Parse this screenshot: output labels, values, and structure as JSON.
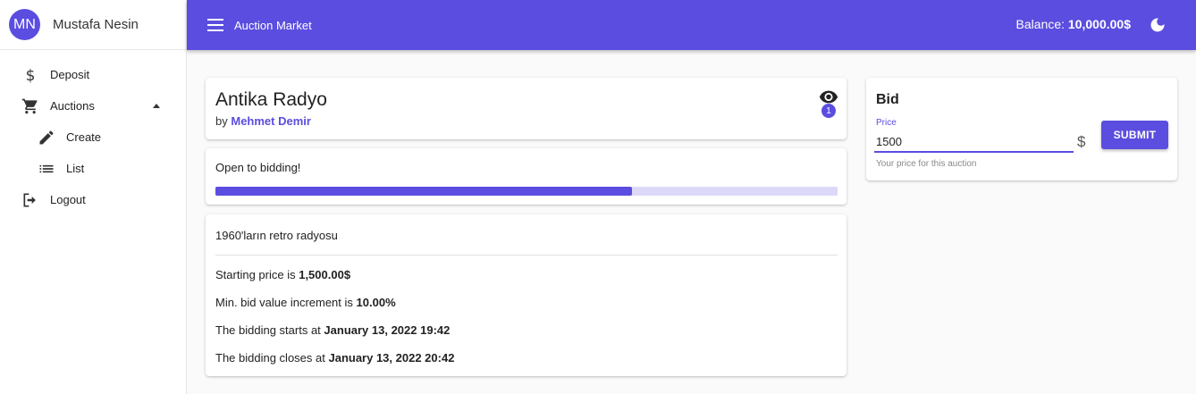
{
  "user": {
    "initials": "MN",
    "name": "Mustafa Nesin"
  },
  "sidebar": {
    "items": [
      {
        "label": "Deposit",
        "icon": "dollar-icon"
      },
      {
        "label": "Auctions",
        "icon": "cart-icon"
      },
      {
        "label": "Create",
        "icon": "pencil-icon"
      },
      {
        "label": "List",
        "icon": "list-icon"
      },
      {
        "label": "Logout",
        "icon": "logout-icon"
      }
    ]
  },
  "topbar": {
    "title": "Auction Market",
    "balance_label": "Balance:",
    "balance_value": "10,000.00$"
  },
  "auction": {
    "name": "Antika Radyo",
    "by_prefix": "by",
    "seller": "Mehmet Demir",
    "watchers": "1",
    "status": "Open to bidding!",
    "progress_fraction": 0.67,
    "description": "1960'ların retro radyosu",
    "starting_price_label": "Starting price is",
    "starting_price": "1,500.00$",
    "increment_label": "Min. bid value increment is",
    "increment": "10.00%",
    "starts_label": "The bidding starts at",
    "starts_at": "January 13, 2022 19:42",
    "closes_label": "The bidding closes at",
    "closes_at": "January 13, 2022 20:42"
  },
  "bid": {
    "title": "Bid",
    "price_label": "Price",
    "price_value": "1500",
    "currency": "$",
    "helper": "Your price for this auction",
    "submit_label": "SUBMIT"
  },
  "colors": {
    "primary": "#5b4ddf",
    "progress_track": "#dcd9f8"
  }
}
